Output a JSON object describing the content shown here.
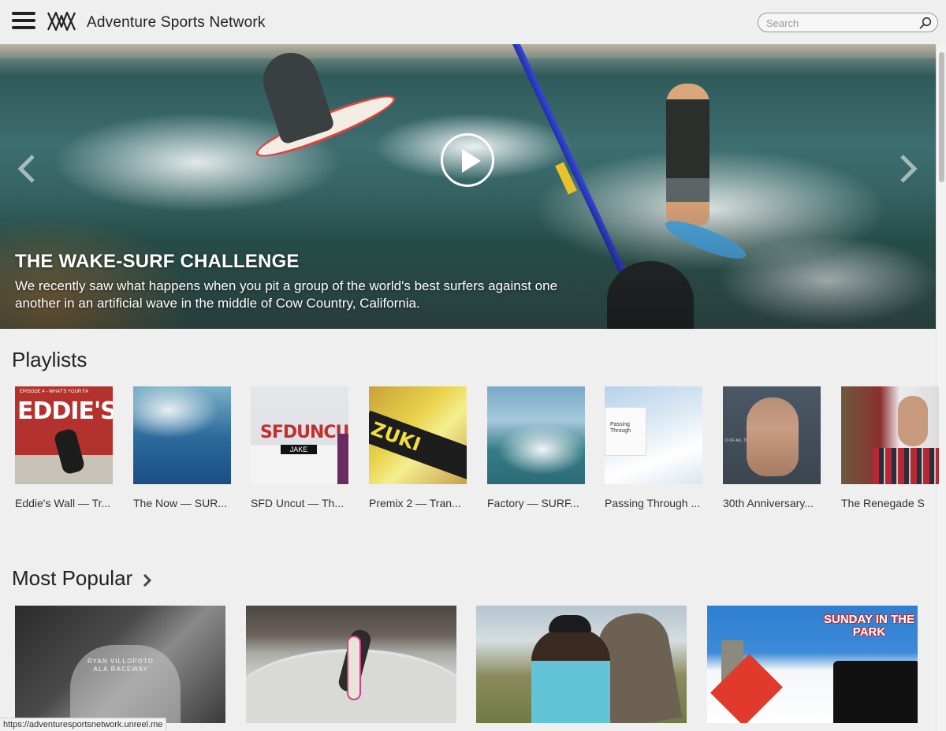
{
  "header": {
    "brand": "Adventure Sports Network",
    "search_placeholder": "Search"
  },
  "hero": {
    "title": "THE WAKE-SURF CHALLENGE",
    "description": "We recently saw what happens when you pit a group of the world's best surfers against one another in an artificial wave in the middle of Cow Country, California."
  },
  "playlists": {
    "title": "Playlists",
    "items": [
      {
        "label": "Eddie's Wall — Tr...",
        "thumb_text": "EDDIE'S",
        "thumb_subtext": "EPISODE 4 - WHAT'S YOUR FA"
      },
      {
        "label": "The Now — SUR..."
      },
      {
        "label": "SFD Uncut — Th...",
        "thumb_text": "SFDUNCUT",
        "thumb_subtext": "JAKE"
      },
      {
        "label": "Premix 2 — Tran...",
        "thumb_text": "ZUKI"
      },
      {
        "label": "Factory — SURF..."
      },
      {
        "label": "Passing Through ...",
        "thumb_text": "Passing Through"
      },
      {
        "label": "30th Anniversary...",
        "thumb_subtext": "D OF ALL TIME"
      },
      {
        "label": "The Renegade Se..."
      }
    ]
  },
  "most_popular": {
    "title": "Most Popular",
    "items": [
      {
        "overlay_text": "RYAN VILLOPOTO",
        "overlay_subtext": "ALA RACEWAY"
      },
      {},
      {},
      {
        "overlay_text": "SUNDAY IN THE PARK"
      }
    ]
  },
  "status_bar": {
    "url": "https://adventuresportsnetwork.unreel.me"
  },
  "colors": {
    "background": "#efefef",
    "text": "#222222",
    "hero_text": "#ffffff"
  }
}
